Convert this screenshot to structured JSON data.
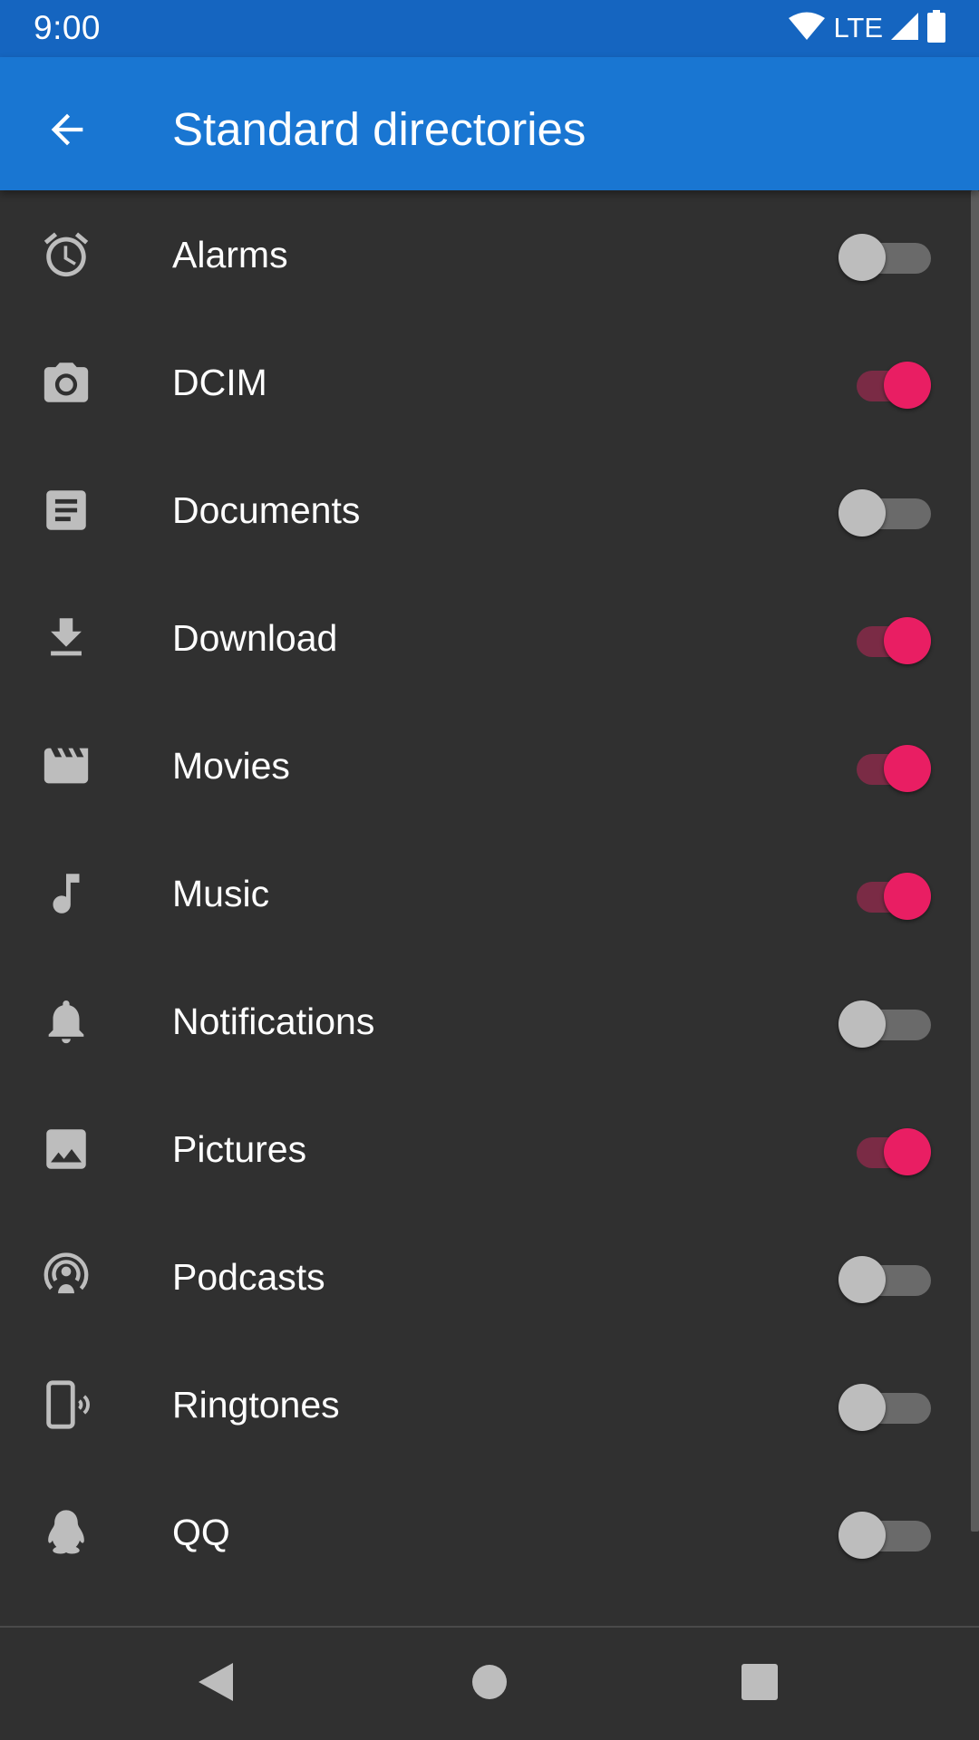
{
  "status_bar": {
    "time": "9:00",
    "network": "LTE",
    "color": "#1565c0"
  },
  "app_bar": {
    "title": "Standard directories",
    "back_icon": "arrow-back-icon",
    "color": "#1976d2"
  },
  "accent_color": "#e91e63",
  "items": [
    {
      "label": "Alarms",
      "icon": "alarm-icon",
      "enabled": false
    },
    {
      "label": "DCIM",
      "icon": "camera-icon",
      "enabled": true
    },
    {
      "label": "Documents",
      "icon": "document-icon",
      "enabled": false
    },
    {
      "label": "Download",
      "icon": "download-icon",
      "enabled": true
    },
    {
      "label": "Movies",
      "icon": "movie-icon",
      "enabled": true
    },
    {
      "label": "Music",
      "icon": "music-note-icon",
      "enabled": true
    },
    {
      "label": "Notifications",
      "icon": "bell-icon",
      "enabled": false
    },
    {
      "label": "Pictures",
      "icon": "image-icon",
      "enabled": true
    },
    {
      "label": "Podcasts",
      "icon": "podcast-icon",
      "enabled": false
    },
    {
      "label": "Ringtones",
      "icon": "ringtone-icon",
      "enabled": false
    },
    {
      "label": "QQ",
      "icon": "penguin-icon",
      "enabled": false
    }
  ],
  "nav_bar": {
    "back": "nav-back-icon",
    "home": "nav-home-icon",
    "recents": "nav-recents-icon"
  }
}
